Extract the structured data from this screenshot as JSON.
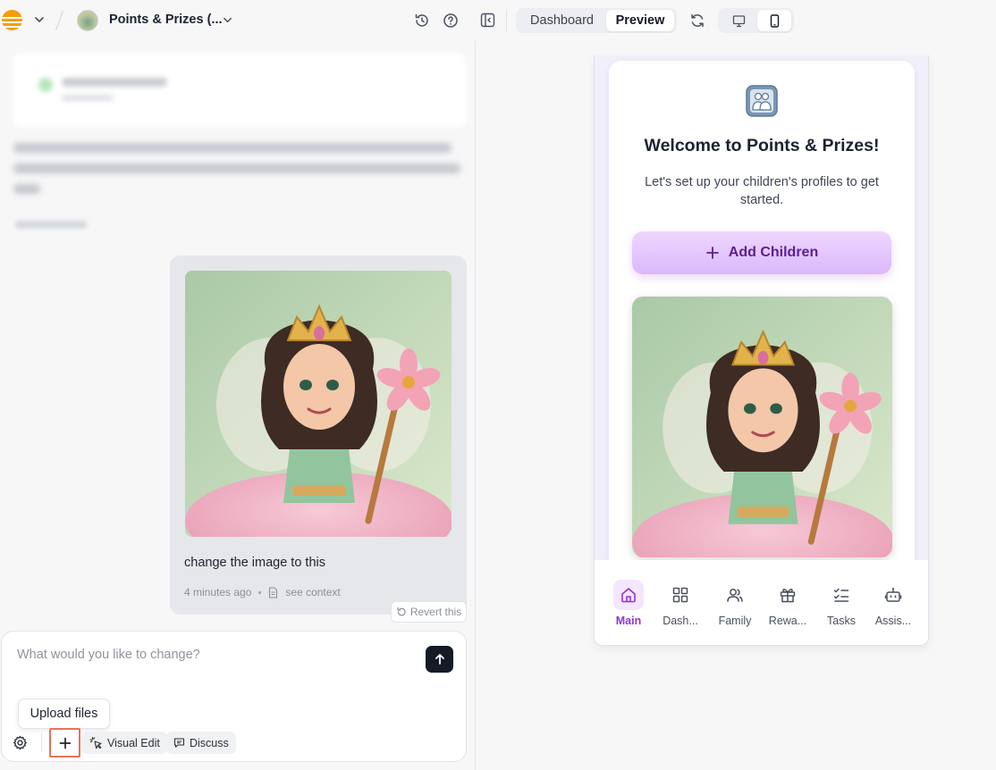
{
  "header": {
    "project_name": "Points & Prizes (...",
    "tabs": [
      {
        "label": "Dashboard",
        "active": false
      },
      {
        "label": "Preview",
        "active": true
      }
    ],
    "device_modes": [
      {
        "icon": "desktop-icon",
        "active": false
      },
      {
        "icon": "mobile-icon",
        "active": true
      }
    ]
  },
  "chat": {
    "user_message": {
      "text": "change the image to this",
      "time": "4 minutes ago",
      "context_link": "see context"
    },
    "revert_label": "Revert this"
  },
  "composer": {
    "placeholder": "What would you like to change?",
    "tooltip": "Upload files",
    "visual_edit_label": "Visual Edit",
    "discuss_label": "Discuss"
  },
  "preview": {
    "welcome_title": "Welcome to Points & Prizes!",
    "welcome_subtitle": "Let's set up your children's profiles to get started.",
    "add_children_label": "Add Children",
    "nav": [
      {
        "label": "Main",
        "icon": "home-icon",
        "active": true
      },
      {
        "label": "Dash...",
        "icon": "grid-icon",
        "active": false
      },
      {
        "label": "Family",
        "icon": "users-icon",
        "active": false
      },
      {
        "label": "Rewa...",
        "icon": "gift-icon",
        "active": false
      },
      {
        "label": "Tasks",
        "icon": "checklist-icon",
        "active": false
      },
      {
        "label": "Assis...",
        "icon": "bot-icon",
        "active": false
      }
    ]
  },
  "colors": {
    "accent_purple": "#9234d6",
    "button_gradient_top": "#eed6ff",
    "button_text": "#5b1f8f",
    "highlight_border": "#e8735a",
    "send_button": "#141a26"
  }
}
